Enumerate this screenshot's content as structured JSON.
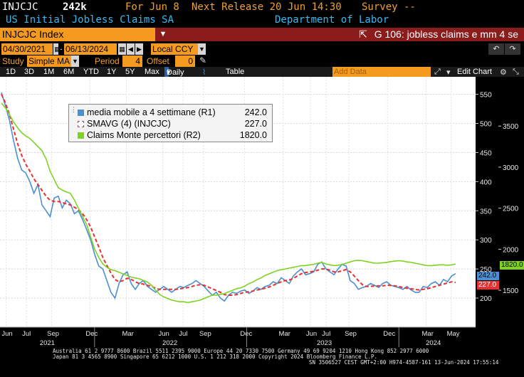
{
  "header": {
    "ticker": "INJCJC",
    "value": "242k",
    "for_label": "For Jun 8",
    "next_release": "Next Release 20 Jun 14:30",
    "survey": "Survey --",
    "description": "US Initial Jobless Claims SA",
    "source": "Department of Labor"
  },
  "security_bar": {
    "security": "INJCJC Index",
    "dropdown_icon": "chevron-down-icon",
    "title": "G 106: jobless claims e mm 4 se"
  },
  "dates": {
    "start": "04/30/2021",
    "end": "06/13/2024",
    "currency": "Local CCY"
  },
  "study": {
    "study_label": "Study",
    "study_value": "Simple MA",
    "period_label": "Period",
    "period_value": "4",
    "offset_label": "Offset",
    "offset_value": "0"
  },
  "toolbar": {
    "ranges": [
      "1D",
      "3D",
      "1M",
      "6M",
      "YTD",
      "1Y",
      "5Y",
      "Max"
    ],
    "frequency": "Daily",
    "table": "Table",
    "add_data": "Add Data",
    "edit_chart": "Edit Chart"
  },
  "legend": {
    "items": [
      {
        "label": "media mobile a 4 settimane (R1)",
        "value": "242.0",
        "color": "#4a8fd1"
      },
      {
        "label": "SMAVG (4) (INJCJC)",
        "value": "227.0",
        "color": "#e83030"
      },
      {
        "label": "Claims Monte percettori  (R2)",
        "value": "1820.0",
        "color": "#7ed321"
      }
    ]
  },
  "badges": {
    "blue": "242.0",
    "red": "227.0",
    "green": "1820.0"
  },
  "chart_data": {
    "type": "line",
    "y_left_ticks": [
      "550",
      "500",
      "450",
      "400",
      "350",
      "300",
      "250",
      "200"
    ],
    "y_right_ticks": [
      "3500",
      "3000",
      "2500",
      "2000",
      "1500"
    ],
    "x_month_labels": [
      "Jun",
      "Jul",
      "Sep",
      "Dec",
      "Mar",
      "Jun",
      "Jul",
      "Sep",
      "Dec",
      "Mar",
      "Jun",
      "Jul",
      "Sep",
      "Dec",
      "Mar",
      "May"
    ],
    "x_year_labels": [
      "2021",
      "2022",
      "2023",
      "2024"
    ],
    "ylim_left": [
      150,
      580
    ],
    "ylim_right": [
      1050,
      4100
    ],
    "series": [
      {
        "name": "media mobile a 4 settimane (R1)",
        "axis": "left",
        "color": "#4a8fd1",
        "values": [
          553,
          530,
          505,
          470,
          440,
          420,
          415,
          400,
          380,
          395,
          360,
          350,
          340,
          372,
          375,
          355,
          368,
          362,
          345,
          350,
          335,
          318,
          300,
          275,
          255,
          250,
          230,
          210,
          200,
          225,
          240,
          245,
          225,
          215,
          225,
          230,
          220,
          215,
          210,
          215,
          220,
          215,
          210,
          215,
          220,
          218,
          222,
          225,
          230,
          225,
          220,
          212,
          205,
          210,
          200,
          195,
          205,
          210,
          208,
          212,
          214,
          208,
          212,
          218,
          215,
          220,
          222,
          228,
          225,
          235,
          230,
          225,
          238,
          245,
          250,
          240,
          242,
          245,
          258,
          262,
          250,
          245,
          240,
          250,
          258,
          255,
          230,
          225,
          215,
          218,
          220,
          225,
          222,
          218,
          225,
          228,
          222,
          220,
          218,
          215,
          220,
          214,
          210,
          210,
          220,
          218,
          225,
          228,
          222,
          232,
          228,
          238,
          242
        ]
      },
      {
        "name": "SMAVG (4) (INJCJC)",
        "axis": "left",
        "color": "#e83030",
        "values": [
          550,
          535,
          515,
          490,
          465,
          445,
          430,
          418,
          405,
          395,
          385,
          375,
          368,
          366,
          366,
          364,
          362,
          360,
          356,
          352,
          345,
          335,
          322,
          305,
          288,
          270,
          256,
          243,
          232,
          228,
          230,
          234,
          232,
          228,
          225,
          224,
          222,
          220,
          217,
          215,
          215,
          215,
          215,
          215,
          216,
          217,
          218,
          220,
          222,
          223,
          222,
          219,
          216,
          213,
          210,
          206,
          205,
          205,
          206,
          208,
          210,
          211,
          212,
          214,
          215,
          217,
          219,
          222,
          225,
          228,
          230,
          231,
          234,
          238,
          242,
          244,
          245,
          246,
          248,
          250,
          250,
          248,
          245,
          245,
          247,
          249,
          245,
          238,
          230,
          223,
          220,
          220,
          221,
          221,
          221,
          222,
          222,
          221,
          220,
          218,
          217,
          216,
          215,
          214,
          215,
          216,
          218,
          220,
          222,
          224,
          226,
          228,
          227
        ]
      },
      {
        "name": "Claims Monte percettori  (R2)",
        "axis": "right",
        "color": "#7ed321",
        "values": [
          3780,
          3720,
          3640,
          3550,
          3480,
          3420,
          3380,
          3350,
          3300,
          3250,
          3200,
          3100,
          2950,
          2850,
          2750,
          2720,
          2700,
          2680,
          2600,
          2500,
          2400,
          2300,
          2150,
          2000,
          1900,
          1820,
          1780,
          1750,
          1740,
          1720,
          1700,
          1680,
          1660,
          1650,
          1640,
          1620,
          1600,
          1560,
          1500,
          1450,
          1420,
          1400,
          1380,
          1370,
          1360,
          1360,
          1350,
          1360,
          1370,
          1380,
          1400,
          1420,
          1440,
          1440,
          1450,
          1460,
          1480,
          1500,
          1520,
          1530,
          1550,
          1580,
          1600,
          1630,
          1650,
          1680,
          1700,
          1720,
          1740,
          1750,
          1760,
          1770,
          1780,
          1790,
          1800,
          1800,
          1810,
          1815,
          1830,
          1840,
          1820,
          1810,
          1800,
          1805,
          1815,
          1830,
          1845,
          1860,
          1865,
          1860,
          1850,
          1840,
          1830,
          1830,
          1835,
          1840,
          1850,
          1855,
          1860,
          1855,
          1845,
          1840,
          1830,
          1820,
          1810,
          1800,
          1800,
          1805,
          1810,
          1810,
          1805,
          1810,
          1820
        ]
      }
    ]
  },
  "footer": {
    "line1": "Australia 61 2 9777 8600 Brazil 5511 2395 9000 Europe 44 20 7330 7500 Germany 49 69 9204 1210 Hong Kong 852 2977 6000",
    "line2": "Japan 81 3 4565 8900          Singapore 65 6212 1000          U.S. 1 212 318 2000          Copyright 2024 Bloomberg Finance L.P.",
    "line3": "SN 3506527 CEST GMT+2:00 H974-4587-161 13-Jun-2024 17:55:14"
  }
}
